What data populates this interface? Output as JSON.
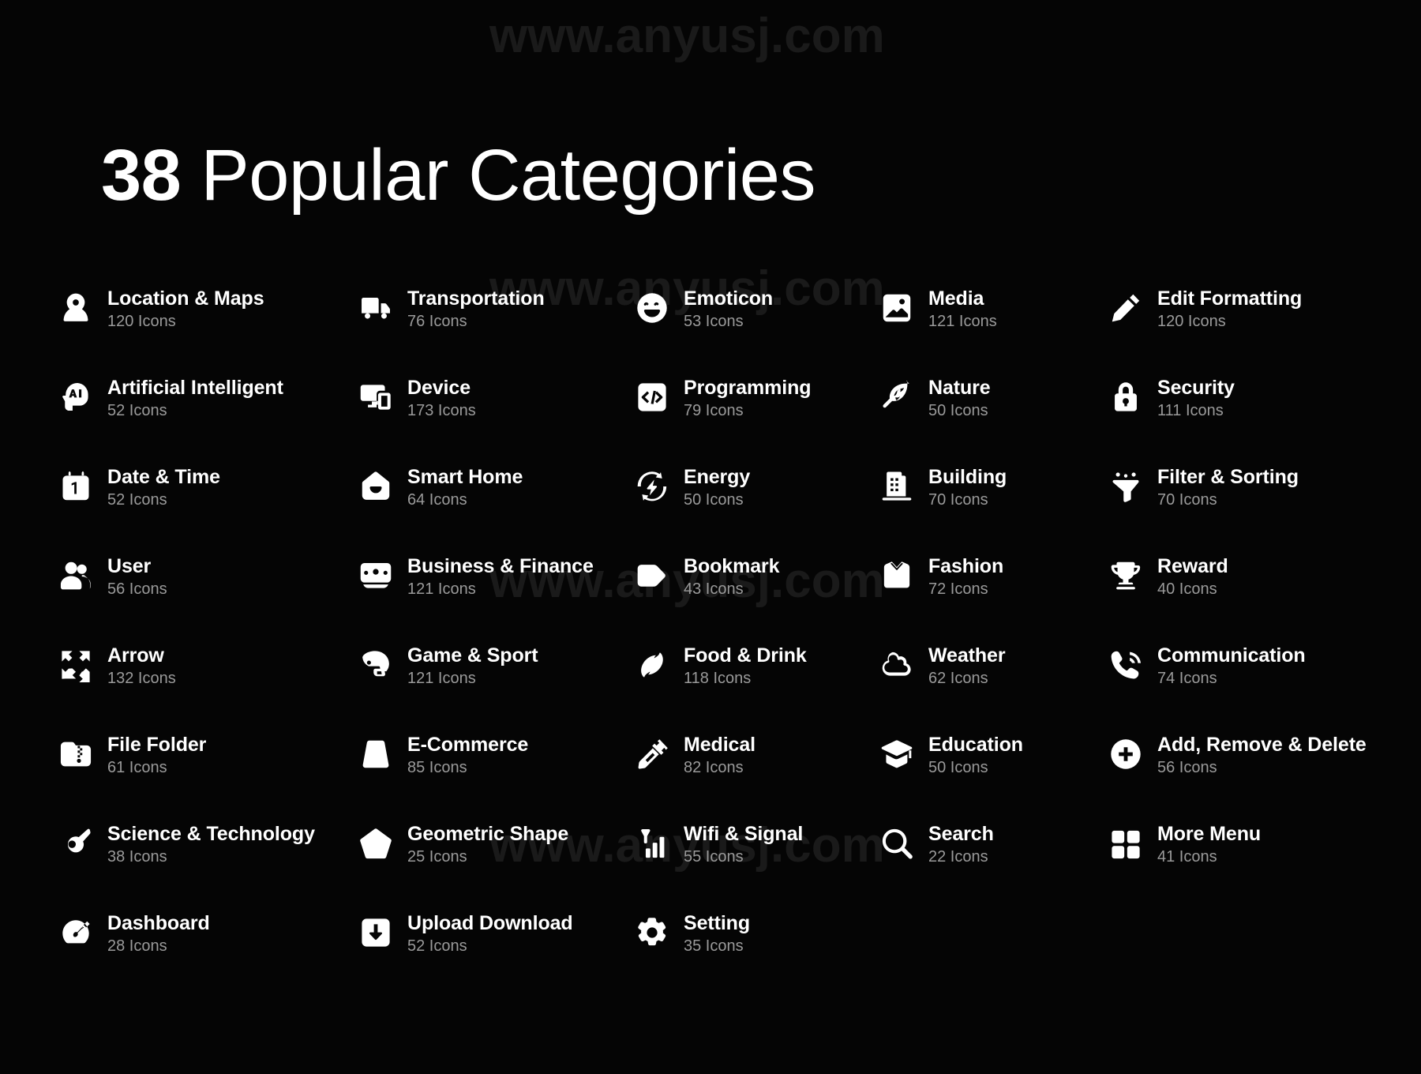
{
  "watermark": {
    "text": "www.anyusj.com",
    "repeats": [
      "www.anyusj.com",
      "www.anyusj.com",
      "www.anyusj.com",
      "www.anyusj.com"
    ]
  },
  "header": {
    "count": "38",
    "title_rest": " Popular Categories",
    "full_title": "38 Popular Categories"
  },
  "colors": {
    "background": "#050505",
    "label": "#ffffff",
    "count": "#9a9a9a",
    "icon": "#ffffff",
    "watermark": "#1a1a1a"
  },
  "units": {
    "icons_suffix": "Icons"
  },
  "grid": {
    "columns": 5,
    "rows": 8,
    "total_categories": 38
  },
  "categories": [
    {
      "label": "Location & Maps",
      "count": "120 Icons",
      "icon": "location-pin-icon",
      "row": 1,
      "col": 1
    },
    {
      "label": "Transportation",
      "count": "76 Icons",
      "icon": "delivery-truck-icon",
      "row": 1,
      "col": 2
    },
    {
      "label": "Emoticon",
      "count": "53 Icons",
      "icon": "smiley-face-icon",
      "row": 1,
      "col": 3
    },
    {
      "label": "Media",
      "count": "121 Icons",
      "icon": "image-photo-icon",
      "row": 1,
      "col": 4
    },
    {
      "label": "Edit Formatting",
      "count": "120 Icons",
      "icon": "pencil-icon",
      "row": 1,
      "col": 5
    },
    {
      "label": "Artificial Intelligent",
      "count": "52 Icons",
      "icon": "ai-head-icon",
      "row": 2,
      "col": 1
    },
    {
      "label": "Device",
      "count": "173 Icons",
      "icon": "monitor-phone-icon",
      "row": 2,
      "col": 2
    },
    {
      "label": "Programming",
      "count": "79 Icons",
      "icon": "code-brackets-icon",
      "row": 2,
      "col": 3
    },
    {
      "label": "Nature",
      "count": "50 Icons",
      "icon": "monstera-leaf-icon",
      "row": 2,
      "col": 4
    },
    {
      "label": "Security",
      "count": "111 Icons",
      "icon": "padlock-icon",
      "row": 2,
      "col": 5
    },
    {
      "label": "Date & Time",
      "count": "52 Icons",
      "icon": "calendar-icon",
      "row": 3,
      "col": 1
    },
    {
      "label": "Smart Home",
      "count": "64 Icons",
      "icon": "smart-home-icon",
      "row": 3,
      "col": 2
    },
    {
      "label": "Energy",
      "count": "50 Icons",
      "icon": "energy-refresh-icon",
      "row": 3,
      "col": 3
    },
    {
      "label": "Building",
      "count": "70 Icons",
      "icon": "office-building-icon",
      "row": 3,
      "col": 4
    },
    {
      "label": "Filter & Sorting",
      "count": "70 Icons",
      "icon": "funnel-filter-icon",
      "row": 3,
      "col": 5
    },
    {
      "label": "User",
      "count": "56 Icons",
      "icon": "users-group-icon",
      "row": 4,
      "col": 1
    },
    {
      "label": "Business & Finance",
      "count": "121 Icons",
      "icon": "banknote-icon",
      "row": 4,
      "col": 2
    },
    {
      "label": "Bookmark",
      "count": "43 Icons",
      "icon": "bookmark-tag-icon",
      "row": 4,
      "col": 3
    },
    {
      "label": "Fashion",
      "count": "72 Icons",
      "icon": "shirt-icon",
      "row": 4,
      "col": 4
    },
    {
      "label": "Reward",
      "count": "40 Icons",
      "icon": "trophy-icon",
      "row": 4,
      "col": 5
    },
    {
      "label": "Arrow",
      "count": "132 Icons",
      "icon": "four-arrows-icon",
      "row": 5,
      "col": 1
    },
    {
      "label": "Game & Sport",
      "count": "121 Icons",
      "icon": "football-helmet-icon",
      "row": 5,
      "col": 2
    },
    {
      "label": "Food & Drink",
      "count": "118 Icons",
      "icon": "coffee-bean-icon",
      "row": 5,
      "col": 3
    },
    {
      "label": "Weather",
      "count": "62 Icons",
      "icon": "cloud-icon",
      "row": 5,
      "col": 4
    },
    {
      "label": "Communication",
      "count": "74 Icons",
      "icon": "phone-call-icon",
      "row": 5,
      "col": 5
    },
    {
      "label": "File Folder",
      "count": "61 Icons",
      "icon": "folder-zip-icon",
      "row": 6,
      "col": 1
    },
    {
      "label": "E-Commerce",
      "count": "85 Icons",
      "icon": "shopping-bag-icon",
      "row": 6,
      "col": 2
    },
    {
      "label": "Medical",
      "count": "82 Icons",
      "icon": "syringe-icon",
      "row": 6,
      "col": 3
    },
    {
      "label": "Education",
      "count": "50 Icons",
      "icon": "graduation-cap-icon",
      "row": 6,
      "col": 4
    },
    {
      "label": "Add, Remove & Delete",
      "count": "56 Icons",
      "icon": "plus-circle-icon",
      "row": 6,
      "col": 5
    },
    {
      "label": "Science & Technology",
      "count": "38 Icons",
      "icon": "comet-icon",
      "row": 7,
      "col": 1
    },
    {
      "label": "Geometric Shape",
      "count": "25 Icons",
      "icon": "pentagon-icon",
      "row": 7,
      "col": 2
    },
    {
      "label": "Wifi & Signal",
      "count": "55 Icons",
      "icon": "signal-bars-icon",
      "row": 7,
      "col": 3
    },
    {
      "label": "Search",
      "count": "22 Icons",
      "icon": "magnifier-icon",
      "row": 7,
      "col": 4
    },
    {
      "label": "More Menu",
      "count": "41 Icons",
      "icon": "grid-menu-icon",
      "row": 7,
      "col": 5
    },
    {
      "label": "Dashboard",
      "count": "28 Icons",
      "icon": "gauge-dashboard-icon",
      "row": 8,
      "col": 1
    },
    {
      "label": "Upload Download",
      "count": "52 Icons",
      "icon": "download-box-icon",
      "row": 8,
      "col": 2
    },
    {
      "label": "Setting",
      "count": "35 Icons",
      "icon": "gear-icon",
      "row": 8,
      "col": 3
    }
  ]
}
